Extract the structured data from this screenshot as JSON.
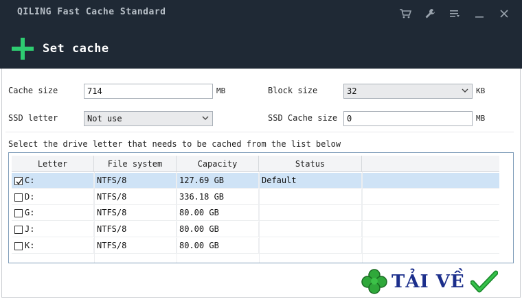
{
  "window": {
    "title": "QILING Fast Cache Standard",
    "icons": [
      "cart-icon",
      "wrench-icon",
      "menu-icon",
      "minimize-icon",
      "close-icon"
    ]
  },
  "header": {
    "action_label": "Set cache",
    "accent_color": "#2ecc71"
  },
  "form": {
    "cache_size_label": "Cache size",
    "cache_size_value": "714",
    "cache_size_unit": "MB",
    "block_size_label": "Block size",
    "block_size_value": "32",
    "block_size_unit": "KB",
    "ssd_letter_label": "SSD letter",
    "ssd_letter_value": "Not use",
    "ssd_cache_size_label": "SSD Cache size",
    "ssd_cache_size_value": "0",
    "ssd_cache_size_unit": "MB"
  },
  "instruction": "Select the drive letter that needs to be cached from the list below",
  "table": {
    "columns": [
      "Letter",
      "File system",
      "Capacity",
      "Status"
    ],
    "rows": [
      {
        "letter": "C:",
        "fs": "NTFS/8",
        "capacity": "127.69 GB",
        "status": "Default",
        "checked": true
      },
      {
        "letter": "D:",
        "fs": "NTFS/8",
        "capacity": "336.18 GB",
        "status": "",
        "checked": false
      },
      {
        "letter": "G:",
        "fs": "NTFS/8",
        "capacity": "80.00 GB",
        "status": "",
        "checked": false
      },
      {
        "letter": "J:",
        "fs": "NTFS/8",
        "capacity": "80.00 GB",
        "status": "",
        "checked": false
      },
      {
        "letter": "K:",
        "fs": "NTFS/8",
        "capacity": "80.00 GB",
        "status": "",
        "checked": false
      }
    ]
  },
  "watermark": {
    "text": "TẢI VỀ"
  }
}
